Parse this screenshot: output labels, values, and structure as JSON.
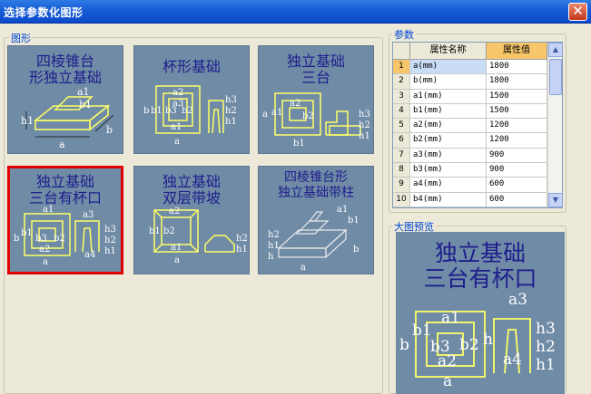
{
  "window": {
    "title": "选择参数化图形",
    "close_glyph": "✕"
  },
  "shapes_group": {
    "label": "图形"
  },
  "params_group": {
    "label": "参数"
  },
  "preview_group": {
    "label": "大图预览"
  },
  "thumbnails": [
    {
      "line1": "四棱锥台",
      "line2": "形独立基础",
      "dims": [
        "a1",
        "b1",
        "h1",
        "a",
        "b"
      ]
    },
    {
      "line1": "杯形基础",
      "line2": "",
      "dims": [
        "a2",
        "b3",
        "b2",
        "b",
        "b1",
        "a3",
        "h3",
        "h2",
        "h1",
        "a1",
        "a"
      ]
    },
    {
      "line1": "独立基础",
      "line2": "三台",
      "dims": [
        "a",
        "b2",
        "b1",
        "a2",
        "a1",
        "h3",
        "h2",
        "h1"
      ]
    },
    {
      "line1": "独立基础",
      "line2": "三台有杯口",
      "dims": [
        "a1",
        "a3",
        "b1",
        "b3",
        "b2",
        "h3",
        "h2",
        "h1",
        "a2",
        "a4",
        "a",
        "b"
      ]
    },
    {
      "line1": "独立基础",
      "line2": "双层带坡",
      "dims": [
        "a2",
        "b2",
        "b1",
        "a1",
        "a",
        "h2",
        "h1"
      ]
    },
    {
      "line1": "四棱锥台形",
      "line2": "独立基础带柱",
      "dims": [
        "a1",
        "b1",
        "h2",
        "h1",
        "h",
        "a",
        "b"
      ]
    }
  ],
  "table": {
    "headers": [
      "",
      "属性名称",
      "属性值"
    ],
    "rows": [
      [
        "1",
        "a(mm)",
        "1800"
      ],
      [
        "2",
        "b(mm)",
        "1800"
      ],
      [
        "3",
        "a1(mm)",
        "1500"
      ],
      [
        "4",
        "b1(mm)",
        "1500"
      ],
      [
        "5",
        "a2(mm)",
        "1200"
      ],
      [
        "6",
        "b2(mm)",
        "1200"
      ],
      [
        "7",
        "a3(mm)",
        "900"
      ],
      [
        "8",
        "b3(mm)",
        "900"
      ],
      [
        "9",
        "a4(mm)",
        "600"
      ],
      [
        "10",
        "b4(mm)",
        "600"
      ]
    ],
    "selected_row": 1
  },
  "preview": {
    "line1": "独立基础",
    "line2": "三台有杯口",
    "dims": [
      "a1",
      "b1",
      "a3",
      "b3",
      "b2",
      "h3",
      "h2",
      "h1",
      "a2",
      "a4",
      "a",
      "b",
      "h"
    ]
  },
  "colors": {
    "thumb_bg": "#6F8BA6",
    "title_text": "#1E1E8C",
    "outline": "#FFFF66",
    "selected_border": "#E00000"
  }
}
